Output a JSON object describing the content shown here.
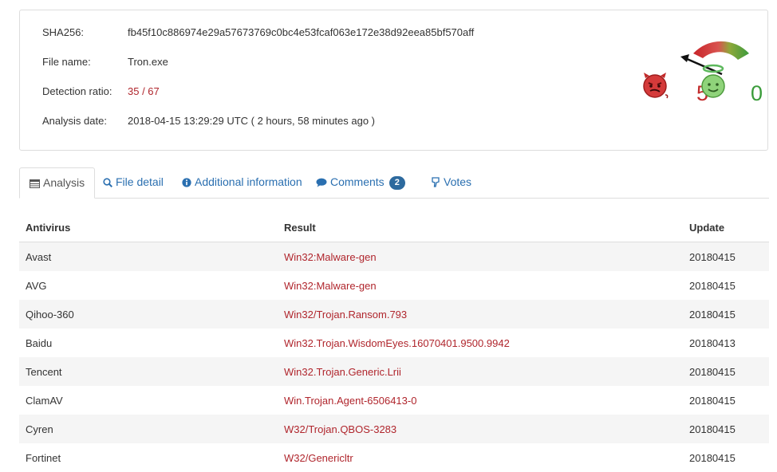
{
  "info": {
    "sha256_label": "SHA256:",
    "sha256_value": "fb45f10c886974e29a57673769c0bc4e53fcaf063e172e38d92eea85bf570aff",
    "filename_label": "File name:",
    "filename_value": "Tron.exe",
    "detection_label": "Detection ratio:",
    "detection_value": "35 / 67",
    "date_label": "Analysis date:",
    "date_value": "2018-04-15 13:29:29 UTC ( 2 hours, 58 minutes ago )"
  },
  "votes": {
    "malicious_count": "5",
    "harmless_count": "0",
    "malicious_icon": "devil-face-icon",
    "harmless_icon": "angel-face-icon"
  },
  "tabs": [
    {
      "label": "Analysis",
      "icon": "table-icon",
      "active": true
    },
    {
      "label": "File detail",
      "icon": "magnifier-icon"
    },
    {
      "label": "Additional information",
      "icon": "info-circle-icon"
    },
    {
      "label": "Comments",
      "icon": "speech-bubble-icon",
      "badge": "2"
    },
    {
      "label": "Votes",
      "icon": "thumbs-icon"
    }
  ],
  "table": {
    "headers": [
      "Antivirus",
      "Result",
      "Update"
    ],
    "rows": [
      {
        "antivirus": "Avast",
        "result": "Win32:Malware-gen",
        "update": "20180415"
      },
      {
        "antivirus": "AVG",
        "result": "Win32:Malware-gen",
        "update": "20180415"
      },
      {
        "antivirus": "Qihoo-360",
        "result": "Win32/Trojan.Ransom.793",
        "update": "20180415"
      },
      {
        "antivirus": "Baidu",
        "result": "Win32.Trojan.WisdomEyes.16070401.9500.9942",
        "update": "20180413"
      },
      {
        "antivirus": "Tencent",
        "result": "Win32.Trojan.Generic.Lrii",
        "update": "20180415"
      },
      {
        "antivirus": "ClamAV",
        "result": "Win.Trojan.Agent-6506413-0",
        "update": "20180415"
      },
      {
        "antivirus": "Cyren",
        "result": "W32/Trojan.QBOS-3283",
        "update": "20180415"
      },
      {
        "antivirus": "Fortinet",
        "result": "W32/Genericltr",
        "update": "20180415"
      }
    ]
  },
  "colors": {
    "malicious": "#c22b2b",
    "harmless": "#3a9c3a",
    "link": "#2a6fb0",
    "result_red": "#b0262d"
  }
}
